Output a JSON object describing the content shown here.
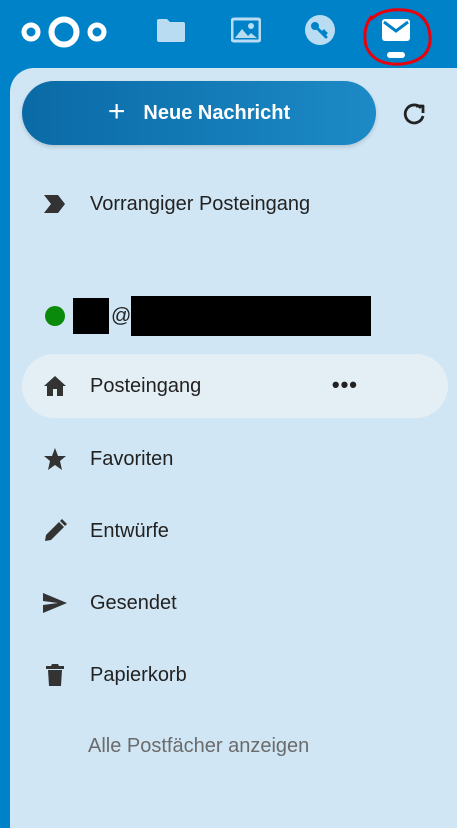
{
  "topbar": {
    "apps": [
      {
        "name": "files-icon"
      },
      {
        "name": "photos-icon"
      },
      {
        "name": "passwords-icon"
      },
      {
        "name": "mail-icon"
      }
    ],
    "brand_color": "#0082c9"
  },
  "compose": {
    "new_message_label": "Neue Nachricht"
  },
  "mailboxes": {
    "priority_inbox": "Vorrangiger Posteingang",
    "account": {
      "at_sign": "@",
      "status_color": "#0a8a0a"
    },
    "items": [
      {
        "label": "Posteingang",
        "icon": "home-icon",
        "active": true
      },
      {
        "label": "Favoriten",
        "icon": "star-icon"
      },
      {
        "label": "Entwürfe",
        "icon": "pencil-icon"
      },
      {
        "label": "Gesendet",
        "icon": "send-icon"
      },
      {
        "label": "Papierkorb",
        "icon": "trash-icon"
      }
    ],
    "more_label": "•••",
    "show_all_label": "Alle Postfächer anzeigen"
  }
}
